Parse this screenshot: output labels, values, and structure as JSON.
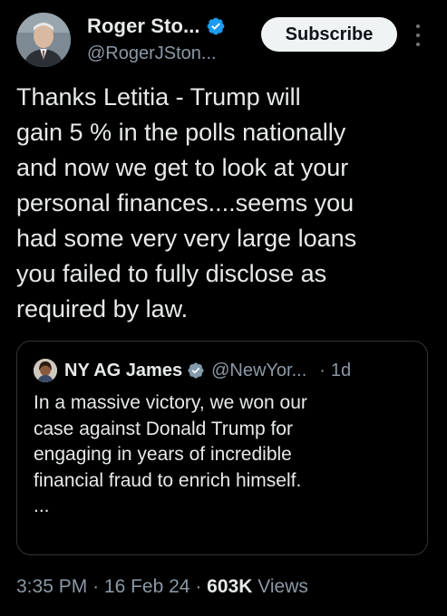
{
  "author": {
    "display_name": "Roger Sto...",
    "handle": "@RogerJSton...",
    "avatar_icon": "user-photo-avatar",
    "verified_icon": "verified-badge-icon",
    "verified_color": "#1d9bf0"
  },
  "subscribe_label": "Subscribe",
  "more_icon": "more-vertical-icon",
  "tweet": {
    "lines": [
      "Thanks Letitia - Trump will",
      "gain 5 % in the polls nationally",
      "and now we get to look at your",
      "personal finances....seems you",
      "had some very very large loans",
      "you failed to fully disclose as",
      "required by law."
    ]
  },
  "quoted": {
    "display_name": "NY AG James",
    "handle": "@NewYor...",
    "separator": "·",
    "time": "1d",
    "verified_color": "#829aab",
    "lines": [
      "In a massive victory, we won our",
      "case against Donald Trump for",
      "engaging in years of incredible",
      "financial fraud to enrich himself.",
      "..."
    ]
  },
  "meta": {
    "time": "3:35 PM",
    "separator": "·",
    "date": "16 Feb 24",
    "views_count": "603K",
    "views_label": "Views"
  }
}
